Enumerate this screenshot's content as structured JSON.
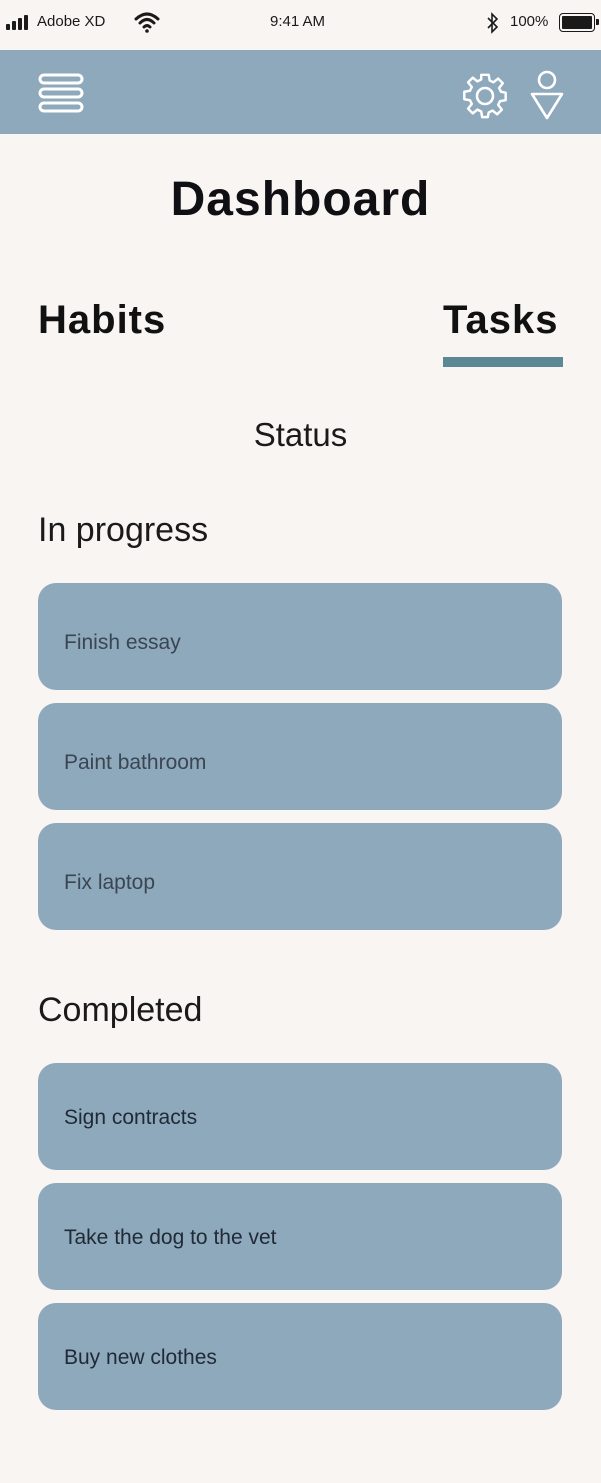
{
  "status_bar": {
    "carrier": "Adobe XD",
    "time": "9:41 AM",
    "battery": "100%"
  },
  "app_bar": {
    "menu_icon": "hamburger-menu-icon",
    "settings_icon": "gear-icon",
    "profile_icon": "profile-icon"
  },
  "page_title": "Dashboard",
  "tabs": [
    {
      "label": "Habits",
      "active": false
    },
    {
      "label": "Tasks",
      "active": true
    }
  ],
  "status_heading": "Status",
  "sections": {
    "in_progress": {
      "title": "In progress",
      "tasks": [
        "Finish essay",
        "Paint bathroom",
        "Fix laptop"
      ]
    },
    "completed": {
      "title": "Completed",
      "tasks": [
        "Sign contracts",
        "Take the dog to the vet",
        "Buy new clothes"
      ]
    }
  },
  "colors": {
    "background": "#f8f5f3",
    "app_bar": "#8ea8bc",
    "card": "#8ea8bc",
    "tab_underline": "#5c8894"
  }
}
